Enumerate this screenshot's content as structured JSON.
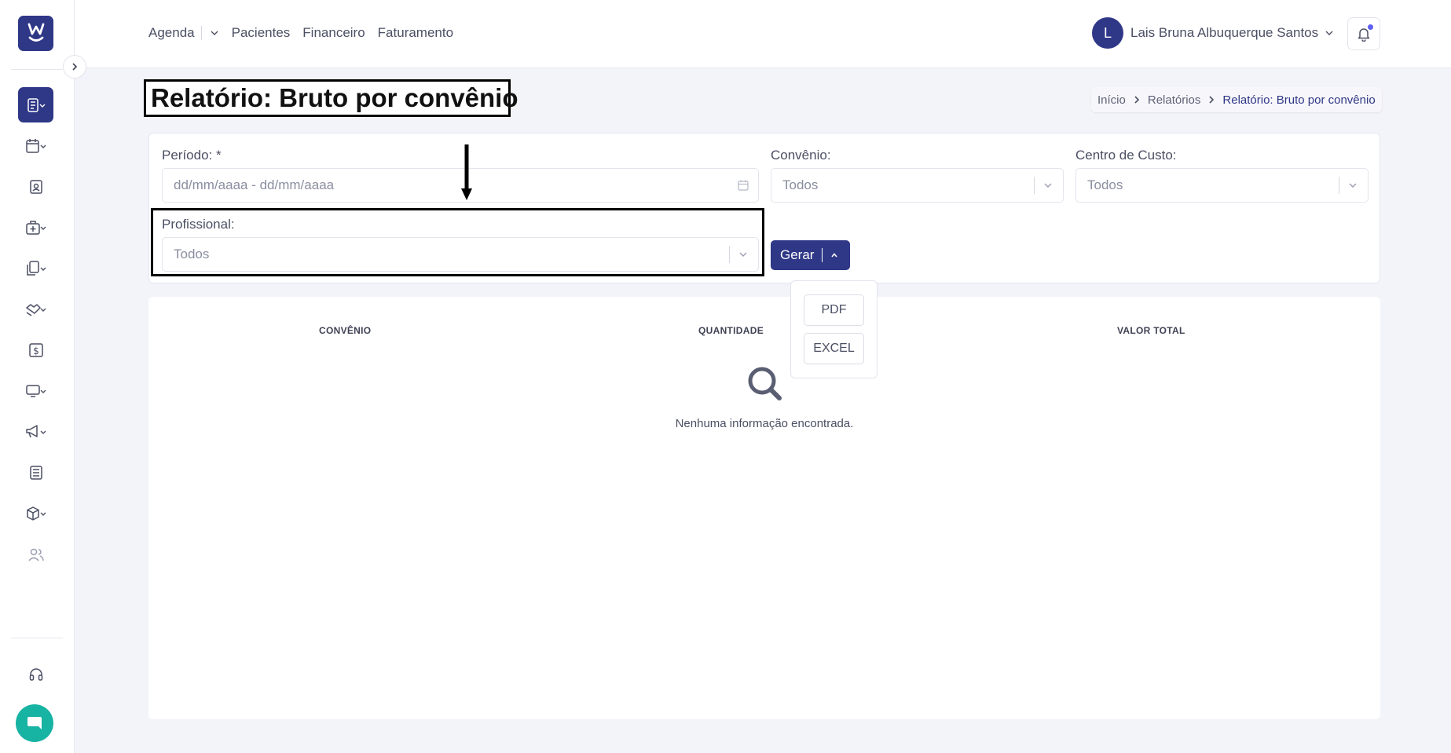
{
  "sidebar": {
    "logo_letter": "W",
    "items": [
      {
        "icon": "report-icon",
        "active": true,
        "dropdown": true
      },
      {
        "icon": "calendar-icon",
        "dropdown": true
      },
      {
        "icon": "patient-badge-icon",
        "dropdown": false
      },
      {
        "icon": "medical-case-icon",
        "dropdown": true
      },
      {
        "icon": "documents-icon",
        "dropdown": true
      },
      {
        "icon": "handshake-icon",
        "dropdown": true
      },
      {
        "icon": "dollar-icon",
        "dropdown": false
      },
      {
        "icon": "monitor-icon",
        "dropdown": true
      },
      {
        "icon": "megaphone-icon",
        "dropdown": true
      },
      {
        "icon": "newspaper-icon",
        "dropdown": false
      },
      {
        "icon": "box-icon",
        "dropdown": true
      },
      {
        "icon": "users-icon",
        "dropdown": false
      }
    ],
    "support_icon": "headset-icon",
    "chat_icon": "chat-icon"
  },
  "topnav": {
    "agenda": "Agenda",
    "pacientes": "Pacientes",
    "financeiro": "Financeiro",
    "faturamento": "Faturamento"
  },
  "user": {
    "initial": "L",
    "name": "Lais Bruna Albuquerque Santos"
  },
  "page": {
    "title": "Relatório: Bruto por convênio"
  },
  "breadcrumb": {
    "home": "Início",
    "reports": "Relatórios",
    "current": "Relatório: Bruto por convênio"
  },
  "filters": {
    "periodo_label": "Período: *",
    "periodo_placeholder": "dd/mm/aaaa - dd/mm/aaaa",
    "convenio_label": "Convênio:",
    "convenio_value": "Todos",
    "centro_label": "Centro de Custo:",
    "centro_value": "Todos",
    "profissional_label": "Profissional:",
    "profissional_value": "Todos"
  },
  "gerar": {
    "label": "Gerar",
    "options": [
      "PDF",
      "EXCEL"
    ]
  },
  "table": {
    "columns": [
      "CONVÊNIO",
      "QUANTIDADE",
      "VALOR TOTAL"
    ],
    "empty_text": "Nenhuma informação encontrada."
  },
  "colors": {
    "primary": "#2f3787",
    "chat": "#17b3a3",
    "notification_dot": "#5c5ff0"
  }
}
